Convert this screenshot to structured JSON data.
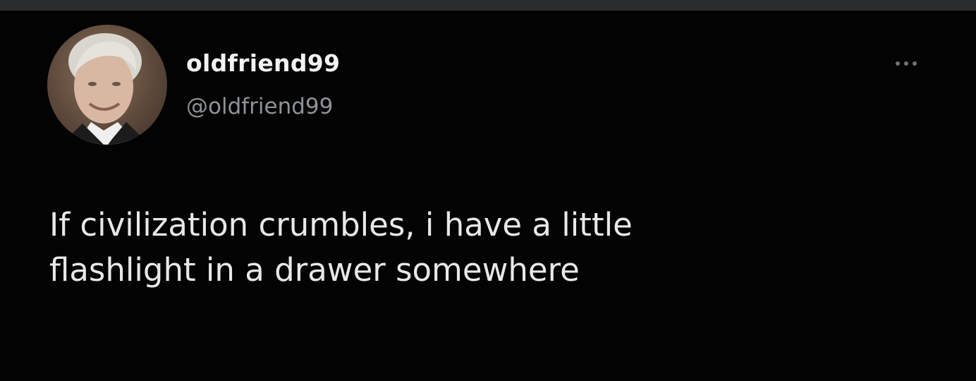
{
  "tweet": {
    "author": {
      "display_name": "oldfriend99",
      "handle": "@oldfriend99",
      "avatar_icon": "avatar-photo"
    },
    "more_icon": "ellipsis-icon",
    "text": "If civilization crumbles, i have a little\nflashlight in a drawer somewhere"
  },
  "colors": {
    "background": "#030303",
    "top_bar": "#2a2c30",
    "name": "#f2f2f2",
    "handle": "#8e9296",
    "body_text": "#e8e8e8"
  }
}
